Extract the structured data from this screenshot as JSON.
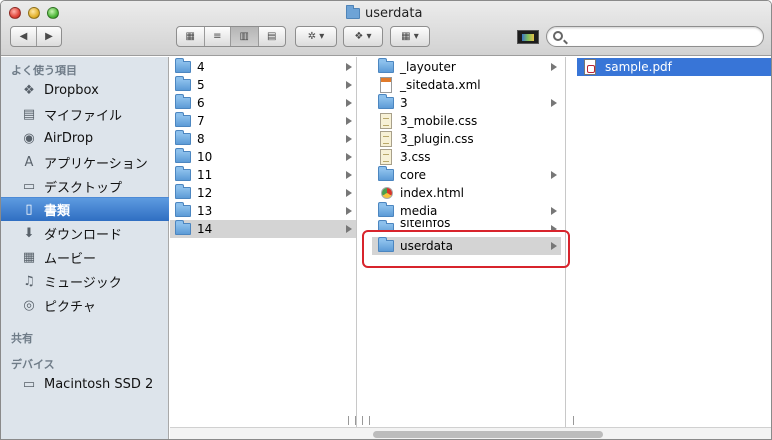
{
  "window": {
    "title": "userdata"
  },
  "toolbar": {
    "nav_back": "◀",
    "nav_forward": "▶",
    "view_icon": "▦",
    "view_list": "≡",
    "view_column": "▥",
    "view_coverflow": "▤",
    "action_label": "✲ ▾",
    "dropbox_label": "❖ ▾",
    "arrange_label": "▦ ▾"
  },
  "search": {
    "placeholder": ""
  },
  "sidebar": {
    "favorites_header": "よく使う項目",
    "shared_header": "共有",
    "devices_header": "デバイス",
    "items": [
      {
        "label": "Dropbox",
        "icon": "❖"
      },
      {
        "label": "マイファイル",
        "icon": "▤"
      },
      {
        "label": "AirDrop",
        "icon": "◉"
      },
      {
        "label": "アプリケーション",
        "icon": "A"
      },
      {
        "label": "デスクトップ",
        "icon": "▭"
      },
      {
        "label": "書類",
        "icon": "▯"
      },
      {
        "label": "ダウンロード",
        "icon": "⬇"
      },
      {
        "label": "ムービー",
        "icon": "▦"
      },
      {
        "label": "ミュージック",
        "icon": "♫"
      },
      {
        "label": "ピクチャ",
        "icon": "◎"
      }
    ],
    "devices": [
      {
        "label": "Macintosh SSD 2",
        "icon": "▭"
      }
    ]
  },
  "column1": {
    "items": [
      "4",
      "5",
      "6",
      "7",
      "8",
      "10",
      "11",
      "12",
      "13",
      "14"
    ]
  },
  "column2": {
    "items": [
      "_layouter",
      "_sitedata.xml",
      "3",
      "3_mobile.css",
      "3_plugin.css",
      "3.css",
      "core",
      "index.html",
      "media",
      "siteinfos",
      "userdata"
    ]
  },
  "column3": {
    "items": [
      "sample.pdf"
    ]
  },
  "colors": {
    "selection_blue": "#3875d7",
    "selection_grey": "#d4d4d4",
    "highlight_red": "#d8242c",
    "sidebar_bg": "#dde4eb"
  }
}
